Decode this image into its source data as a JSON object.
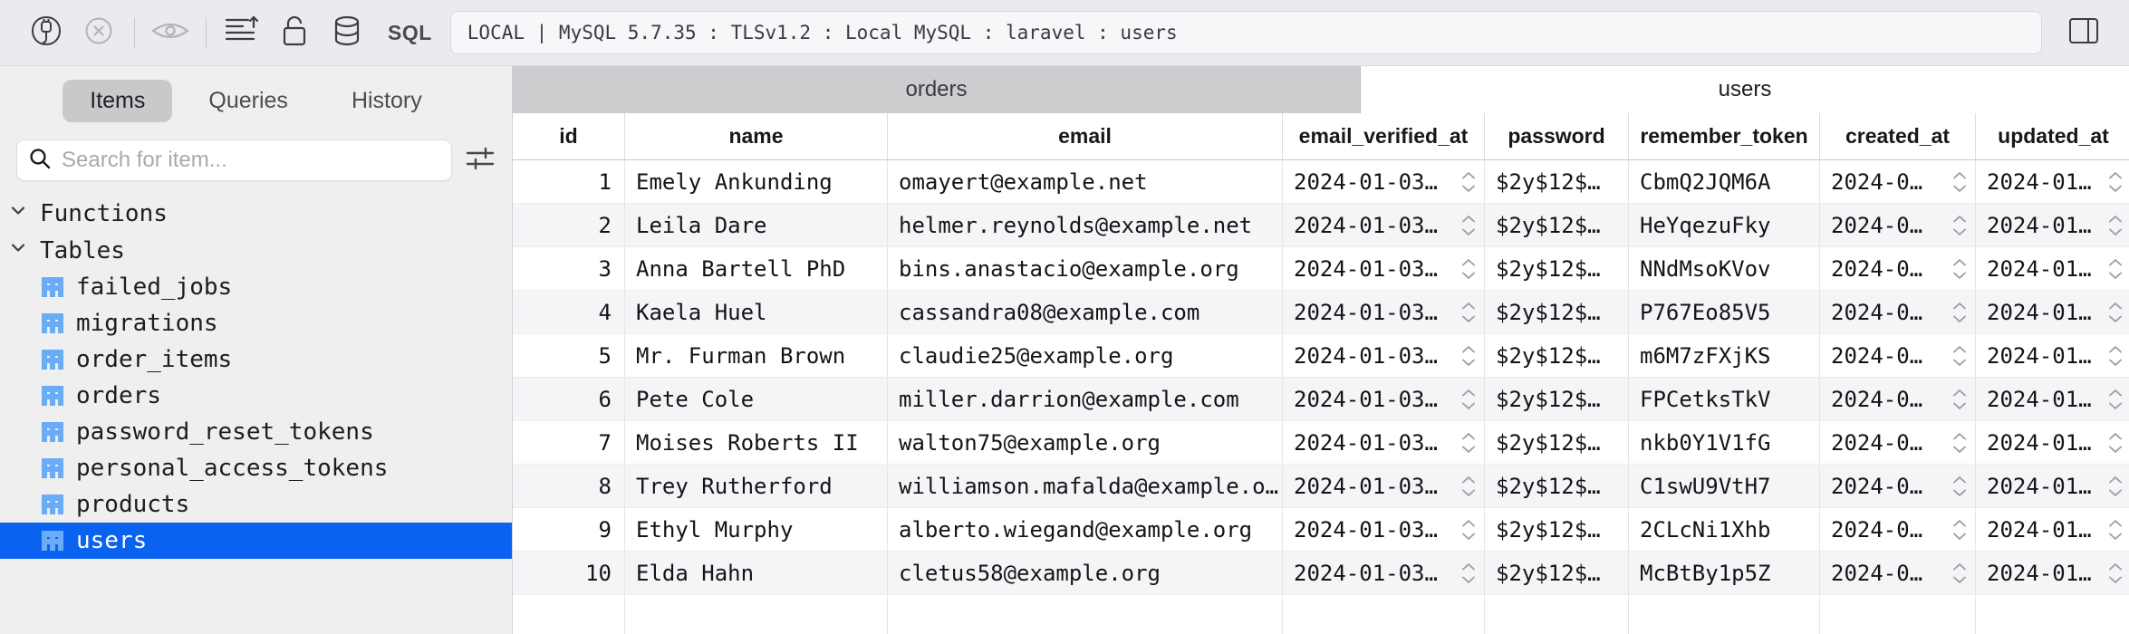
{
  "toolbar": {
    "buttons": [
      {
        "name": "connect-plug-icon",
        "label": "Connect"
      },
      {
        "name": "disconnect-icon",
        "label": "Disconnect"
      },
      {
        "name": "preview-eye-icon",
        "label": "Preview"
      },
      {
        "name": "sort-icon",
        "label": "Sort"
      },
      {
        "name": "lock-icon",
        "label": "Lock"
      },
      {
        "name": "database-icon",
        "label": "Database"
      }
    ],
    "sql_label": "SQL",
    "connection": {
      "value": "LOCAL | MySQL 5.7.35 : TLSv1.2 : Local MySQL : laravel : users",
      "placeholder": "Connection"
    }
  },
  "sidebar": {
    "tabs": [
      {
        "label": "Items",
        "active": true
      },
      {
        "label": "Queries",
        "active": false
      },
      {
        "label": "History",
        "active": false
      }
    ],
    "search": {
      "value": "",
      "placeholder": "Search for item...",
      "icon": "search-icon",
      "filter_icon": "filter-sliders-icon"
    },
    "groups": [
      {
        "label": "Functions",
        "expanded": true,
        "items": []
      },
      {
        "label": "Tables",
        "expanded": true,
        "items": [
          {
            "label": "failed_jobs",
            "selected": false
          },
          {
            "label": "migrations",
            "selected": false
          },
          {
            "label": "order_items",
            "selected": false
          },
          {
            "label": "orders",
            "selected": false
          },
          {
            "label": "password_reset_tokens",
            "selected": false
          },
          {
            "label": "personal_access_tokens",
            "selected": false
          },
          {
            "label": "products",
            "selected": false
          },
          {
            "label": "users",
            "selected": true
          }
        ]
      }
    ],
    "selection_color": "#0a62f0"
  },
  "main": {
    "tabs": [
      {
        "label": "orders",
        "active": false
      },
      {
        "label": "users",
        "active": true
      }
    ],
    "table": {
      "columns": [
        {
          "key": "id",
          "label": "id"
        },
        {
          "key": "name",
          "label": "name"
        },
        {
          "key": "email",
          "label": "email"
        },
        {
          "key": "email_verified_at",
          "label": "email_verified_at"
        },
        {
          "key": "password",
          "label": "password"
        },
        {
          "key": "remember_token",
          "label": "remember_token"
        },
        {
          "key": "created_at",
          "label": "created_at"
        },
        {
          "key": "updated_at",
          "label": "updated_at"
        }
      ],
      "rows": [
        {
          "id": "1",
          "name": "Emely Ankunding",
          "email": "omayert@example.net",
          "email_verified_at": "2024-01-03…",
          "password": "$2y$12$…",
          "remember_token": "CbmQ2JQM6A",
          "created_at": "2024-0…",
          "updated_at": "2024-01…"
        },
        {
          "id": "2",
          "name": "Leila Dare",
          "email": "helmer.reynolds@example.net",
          "email_verified_at": "2024-01-03…",
          "password": "$2y$12$…",
          "remember_token": "HeYqezuFky",
          "created_at": "2024-0…",
          "updated_at": "2024-01…"
        },
        {
          "id": "3",
          "name": "Anna Bartell PhD",
          "email": "bins.anastacio@example.org",
          "email_verified_at": "2024-01-03…",
          "password": "$2y$12$…",
          "remember_token": "NNdMsoKVov",
          "created_at": "2024-0…",
          "updated_at": "2024-01…"
        },
        {
          "id": "4",
          "name": "Kaela Huel",
          "email": "cassandra08@example.com",
          "email_verified_at": "2024-01-03…",
          "password": "$2y$12$…",
          "remember_token": "P767Eo85V5",
          "created_at": "2024-0…",
          "updated_at": "2024-01…"
        },
        {
          "id": "5",
          "name": "Mr. Furman Brown",
          "email": "claudie25@example.org",
          "email_verified_at": "2024-01-03…",
          "password": "$2y$12$…",
          "remember_token": "m6M7zFXjKS",
          "created_at": "2024-0…",
          "updated_at": "2024-01…"
        },
        {
          "id": "6",
          "name": "Pete Cole",
          "email": "miller.darrion@example.com",
          "email_verified_at": "2024-01-03…",
          "password": "$2y$12$…",
          "remember_token": "FPCetksTkV",
          "created_at": "2024-0…",
          "updated_at": "2024-01…"
        },
        {
          "id": "7",
          "name": "Moises Roberts II",
          "email": "walton75@example.org",
          "email_verified_at": "2024-01-03…",
          "password": "$2y$12$…",
          "remember_token": "nkb0Y1V1fG",
          "created_at": "2024-0…",
          "updated_at": "2024-01…"
        },
        {
          "id": "8",
          "name": "Trey Rutherford",
          "email": "williamson.mafalda@example.o…",
          "email_verified_at": "2024-01-03…",
          "password": "$2y$12$…",
          "remember_token": "C1swU9VtH7",
          "created_at": "2024-0…",
          "updated_at": "2024-01…"
        },
        {
          "id": "9",
          "name": "Ethyl Murphy",
          "email": "alberto.wiegand@example.org",
          "email_verified_at": "2024-01-03…",
          "password": "$2y$12$…",
          "remember_token": "2CLcNi1Xhb",
          "created_at": "2024-0…",
          "updated_at": "2024-01…"
        },
        {
          "id": "10",
          "name": "Elda Hahn",
          "email": "cletus58@example.org",
          "email_verified_at": "2024-01-03…",
          "password": "$2y$12$…",
          "remember_token": "McBtBy1p5Z",
          "created_at": "2024-0…",
          "updated_at": "2024-01…"
        }
      ]
    }
  }
}
